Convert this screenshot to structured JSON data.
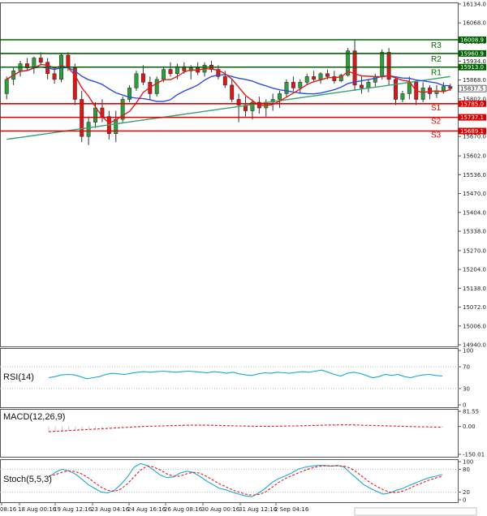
{
  "chart_data": {
    "type": "candlestick",
    "price_axis_ticks": [
      "16134.0",
      "16068.0",
      "16002.0",
      "15934.0",
      "15868.0",
      "15802.0",
      "15736.0",
      "15670.0",
      "15602.0",
      "15536.0",
      "15470.0",
      "15404.0",
      "15338.0",
      "15270.0",
      "15204.0",
      "15138.0",
      "15072.0",
      "15006.0",
      "14940.0"
    ],
    "price_range": [
      14940,
      16134
    ],
    "time_axis_labels": [
      "08:16",
      "18 Aug 00:16",
      "19 Aug 12:16",
      "23 Aug 04:16",
      "24 Aug 16:16",
      "26 Aug 08:16",
      "30 Aug 00:16",
      "31 Aug 12:16",
      "2 Sep 04:16"
    ],
    "current_price": "15837.5",
    "levels": [
      {
        "name": "R3",
        "value": 16008.9,
        "label": "16008.9",
        "color": "#006400"
      },
      {
        "name": "R2",
        "value": 15960.9,
        "label": "15960.9",
        "color": "#006400"
      },
      {
        "name": "R1",
        "value": 15913.0,
        "label": "15913.0",
        "color": "#006400"
      },
      {
        "name": "S1",
        "value": 15785.0,
        "label": "15785.0",
        "color": "#e00000"
      },
      {
        "name": "S2",
        "value": 15737.1,
        "label": "15737.1",
        "color": "#e00000"
      },
      {
        "name": "S3",
        "value": 15689.1,
        "label": "15689.1",
        "color": "#e00000"
      }
    ],
    "candles": [
      [
        15820,
        15880,
        15800,
        15870
      ],
      [
        15870,
        15910,
        15850,
        15900
      ],
      [
        15900,
        15935,
        15880,
        15925
      ],
      [
        15925,
        15945,
        15900,
        15910
      ],
      [
        15910,
        15950,
        15890,
        15945
      ],
      [
        15945,
        15965,
        15920,
        15930
      ],
      [
        15930,
        15945,
        15870,
        15890
      ],
      [
        15890,
        15905,
        15855,
        15870
      ],
      [
        15870,
        15960,
        15860,
        15955
      ],
      [
        15955,
        15965,
        15900,
        15910
      ],
      [
        15910,
        15925,
        15780,
        15800
      ],
      [
        15800,
        15830,
        15650,
        15670
      ],
      [
        15670,
        15740,
        15640,
        15720
      ],
      [
        15720,
        15790,
        15700,
        15770
      ],
      [
        15770,
        15800,
        15720,
        15740
      ],
      [
        15740,
        15760,
        15660,
        15680
      ],
      [
        15680,
        15760,
        15650,
        15730
      ],
      [
        15730,
        15810,
        15720,
        15800
      ],
      [
        15800,
        15850,
        15790,
        15840
      ],
      [
        15840,
        15900,
        15830,
        15890
      ],
      [
        15890,
        15920,
        15850,
        15860
      ],
      [
        15860,
        15880,
        15800,
        15820
      ],
      [
        15820,
        15880,
        15810,
        15870
      ],
      [
        15870,
        15915,
        15860,
        15905
      ],
      [
        15905,
        15930,
        15880,
        15890
      ],
      [
        15890,
        15925,
        15870,
        15915
      ],
      [
        15915,
        15930,
        15890,
        15900
      ],
      [
        15900,
        15920,
        15870,
        15910
      ],
      [
        15910,
        15930,
        15885,
        15895
      ],
      [
        15895,
        15930,
        15880,
        15920
      ],
      [
        15920,
        15935,
        15895,
        15905
      ],
      [
        15905,
        15920,
        15870,
        15880
      ],
      [
        15880,
        15900,
        15840,
        15850
      ],
      [
        15850,
        15870,
        15790,
        15800
      ],
      [
        15800,
        15820,
        15720,
        15780
      ],
      [
        15780,
        15810,
        15740,
        15760
      ],
      [
        15760,
        15800,
        15730,
        15790
      ],
      [
        15790,
        15810,
        15750,
        15770
      ],
      [
        15770,
        15800,
        15740,
        15790
      ],
      [
        15790,
        15820,
        15760,
        15800
      ],
      [
        15800,
        15830,
        15770,
        15820
      ],
      [
        15820,
        15870,
        15810,
        15860
      ],
      [
        15860,
        15880,
        15830,
        15840
      ],
      [
        15840,
        15870,
        15820,
        15860
      ],
      [
        15860,
        15890,
        15850,
        15880
      ],
      [
        15880,
        15900,
        15860,
        15870
      ],
      [
        15870,
        15895,
        15855,
        15890
      ],
      [
        15890,
        15905,
        15870,
        15880
      ],
      [
        15880,
        15900,
        15855,
        15865
      ],
      [
        15865,
        15890,
        15860,
        15885
      ],
      [
        15885,
        15980,
        15880,
        15970
      ],
      [
        15970,
        16010,
        15830,
        15850
      ],
      [
        15850,
        15880,
        15820,
        15840
      ],
      [
        15840,
        15870,
        15825,
        15860
      ],
      [
        15860,
        15890,
        15845,
        15880
      ],
      [
        15880,
        15975,
        15870,
        15965
      ],
      [
        15965,
        15980,
        15850,
        15870
      ],
      [
        15870,
        15880,
        15780,
        15800
      ],
      [
        15800,
        15830,
        15790,
        15820
      ],
      [
        15820,
        15880,
        15800,
        15860
      ],
      [
        15860,
        15870,
        15780,
        15800
      ],
      [
        15800,
        15860,
        15790,
        15840
      ],
      [
        15840,
        15850,
        15800,
        15820
      ],
      [
        15820,
        15850,
        15805,
        15830
      ],
      [
        15830,
        15860,
        15820,
        15845
      ],
      [
        15845,
        15855,
        15830,
        15838
      ]
    ],
    "indicators": {
      "rsi": {
        "label": "RSI(14)",
        "axis_ticks": [
          "100",
          "70",
          "30",
          "0"
        ],
        "range": [
          0,
          100
        ],
        "values": [
          50,
          52,
          55,
          56,
          55,
          52,
          48,
          50,
          52,
          56,
          58,
          57,
          56,
          58,
          60,
          61,
          60,
          61,
          62,
          61,
          60,
          61,
          62,
          61,
          60,
          59,
          61,
          60,
          58,
          60,
          57,
          55,
          54,
          57,
          59,
          58,
          60,
          59,
          58,
          60,
          61,
          60,
          62,
          64,
          60,
          56,
          53,
          58,
          60,
          58,
          54,
          50,
          52,
          56,
          54,
          56,
          52,
          50,
          53,
          55,
          56,
          54,
          53
        ]
      },
      "macd": {
        "label": "MACD(12,26,9)",
        "axis_ticks": [
          "81.55",
          "0.00",
          "-150.01"
        ],
        "range": [
          -150.01,
          81.55
        ],
        "histogram": [
          -30,
          -28,
          -25,
          -22,
          -20,
          -18,
          -15,
          -12,
          -10,
          -8,
          -6,
          -5,
          -3,
          -2,
          0,
          2,
          3,
          4,
          5,
          6,
          7,
          8,
          8,
          8,
          7,
          6,
          5,
          4,
          3,
          2,
          2,
          1,
          0,
          0,
          1,
          2,
          3,
          4,
          5,
          6,
          7,
          8,
          9,
          10,
          10,
          9,
          8,
          7,
          6,
          5,
          4,
          3,
          2,
          1,
          0,
          -1,
          -2,
          -3,
          -3,
          -4
        ],
        "signal": [
          -28,
          -26,
          -24,
          -22,
          -20,
          -18,
          -16,
          -14,
          -12,
          -10,
          -8,
          -6,
          -4,
          -2,
          0,
          1,
          2,
          3,
          4,
          5,
          6,
          7,
          7,
          7,
          7,
          6,
          5,
          4,
          3,
          3,
          2,
          1,
          1,
          1,
          1,
          2,
          3,
          3,
          4,
          5,
          6,
          7,
          8,
          8,
          9,
          9,
          8,
          7,
          6,
          5,
          4,
          3,
          2,
          1,
          0,
          -1,
          -2,
          -2,
          -3,
          -3
        ]
      },
      "stoch": {
        "label": "Stoch(5,5,3)",
        "axis_ticks": [
          "100",
          "80",
          "20",
          "0"
        ],
        "range": [
          0,
          100
        ],
        "k": [
          60,
          72,
          80,
          76,
          68,
          55,
          40,
          30,
          20,
          18,
          25,
          40,
          60,
          85,
          95,
          90,
          78,
          65,
          58,
          60,
          70,
          75,
          72,
          62,
          50,
          40,
          30,
          26,
          20,
          15,
          10,
          8,
          18,
          30,
          45,
          55,
          62,
          70,
          80,
          85,
          88,
          90,
          90,
          88,
          90,
          86,
          70,
          55,
          40,
          30,
          22,
          15,
          18,
          25,
          30,
          38,
          45,
          52,
          58,
          62,
          66
        ],
        "d": [
          62,
          66,
          72,
          76,
          74,
          68,
          58,
          45,
          33,
          25,
          22,
          28,
          42,
          60,
          78,
          88,
          86,
          78,
          68,
          62,
          62,
          68,
          72,
          70,
          62,
          52,
          42,
          34,
          26,
          20,
          15,
          12,
          14,
          20,
          32,
          45,
          55,
          63,
          70,
          77,
          83,
          87,
          89,
          89,
          89,
          88,
          83,
          72,
          58,
          45,
          35,
          26,
          20,
          19,
          23,
          30,
          38,
          45,
          52,
          57,
          62
        ]
      }
    },
    "colors": {
      "up_candle": "#2e9e3c",
      "down_candle": "#d81818",
      "wick": "#333333",
      "ma_red": "#e51a1a",
      "ma_blue": "#2d4de0",
      "ma_green": "#37a36f",
      "rsi_line": "#1aa7d8",
      "macd_hist": "#c4c4c4",
      "macd_signal": "#e51a1a",
      "stoch_k": "#1aa7d8",
      "stoch_d": "#e51a1a"
    }
  }
}
